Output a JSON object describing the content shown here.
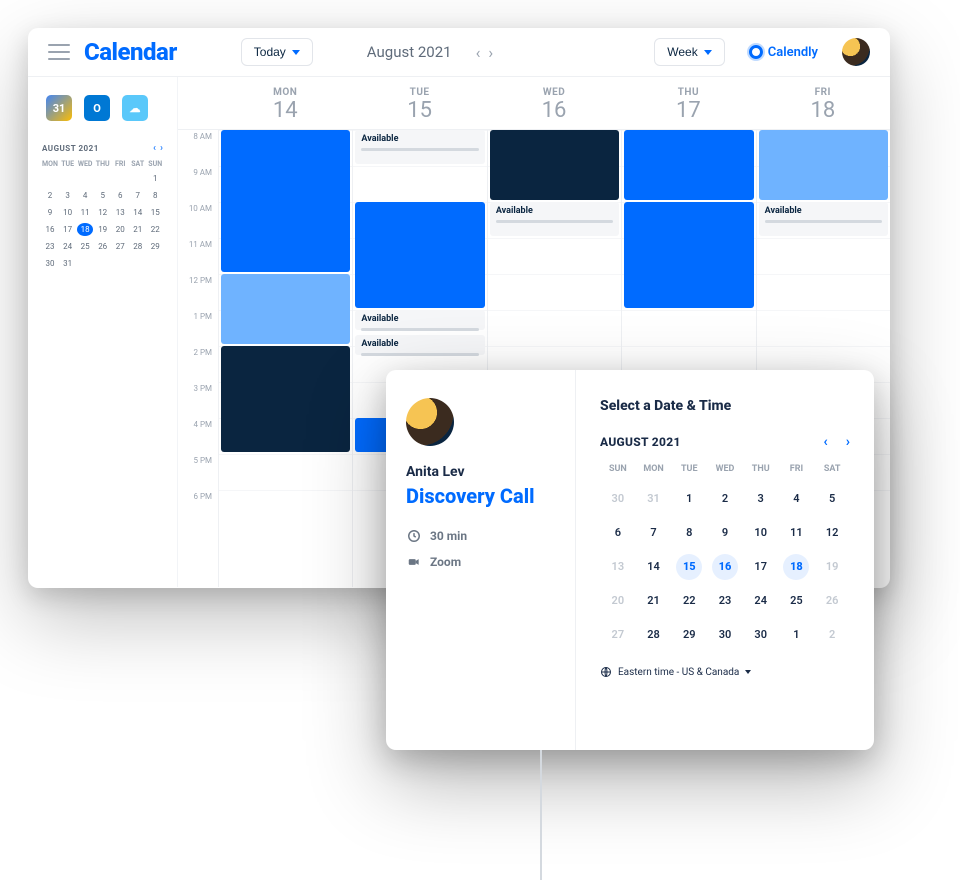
{
  "header": {
    "logo": "Calendar",
    "today_btn": "Today",
    "month_label": "August 2021",
    "view_btn": "Week",
    "calendly_label": "Calendly"
  },
  "integrations": [
    "31",
    "O",
    "☁"
  ],
  "mini_cal": {
    "title": "AUGUST 2021",
    "dow": [
      "MON",
      "TUE",
      "WED",
      "THU",
      "FRI",
      "SAT",
      "SUN"
    ],
    "days": [
      "",
      "",
      "",
      "",
      "",
      "",
      1,
      2,
      3,
      4,
      5,
      6,
      7,
      8,
      9,
      10,
      11,
      12,
      13,
      14,
      15,
      16,
      17,
      18,
      19,
      20,
      21,
      22,
      23,
      24,
      25,
      26,
      27,
      28,
      29,
      30,
      31,
      "",
      "",
      "",
      "",
      ""
    ],
    "today": 18
  },
  "week": {
    "dow": [
      "MON",
      "TUE",
      "WED",
      "THU",
      "FRI"
    ],
    "nums": [
      "14",
      "15",
      "16",
      "17",
      "18"
    ],
    "hours": [
      "8 AM",
      "9 AM",
      "10 AM",
      "11 AM",
      "12 PM",
      "1 PM",
      "2 PM",
      "3 PM",
      "4 PM",
      "5 PM",
      "6 PM"
    ]
  },
  "available_label": "Available",
  "popover": {
    "name": "Anita Lev",
    "event": "Discovery Call",
    "duration": "30 min",
    "platform": "Zoom",
    "title": "Select a Date & Time",
    "month": "AUGUST 2021",
    "dow": [
      "SUN",
      "MON",
      "TUE",
      "WED",
      "THU",
      "FRI",
      "SAT"
    ],
    "days": [
      {
        "n": "30",
        "dim": true
      },
      {
        "n": "31",
        "dim": true
      },
      {
        "n": "1"
      },
      {
        "n": "2"
      },
      {
        "n": "3"
      },
      {
        "n": "4"
      },
      {
        "n": "5"
      },
      {
        "n": "6"
      },
      {
        "n": "7"
      },
      {
        "n": "8"
      },
      {
        "n": "9"
      },
      {
        "n": "10"
      },
      {
        "n": "11"
      },
      {
        "n": "12"
      },
      {
        "n": "13",
        "dim": true
      },
      {
        "n": "14"
      },
      {
        "n": "15",
        "avail": true
      },
      {
        "n": "16",
        "avail": true
      },
      {
        "n": "17"
      },
      {
        "n": "18",
        "avail": true
      },
      {
        "n": "19",
        "dim": true
      },
      {
        "n": "20",
        "dim": true
      },
      {
        "n": "21"
      },
      {
        "n": "22"
      },
      {
        "n": "23"
      },
      {
        "n": "24"
      },
      {
        "n": "25"
      },
      {
        "n": "26",
        "dim": true
      },
      {
        "n": "27",
        "dim": true
      },
      {
        "n": "28"
      },
      {
        "n": "29"
      },
      {
        "n": "30"
      },
      {
        "n": "30"
      },
      {
        "n": "1"
      },
      {
        "n": "2",
        "dim": true
      }
    ],
    "timezone": "Eastern time - US & Canada"
  }
}
